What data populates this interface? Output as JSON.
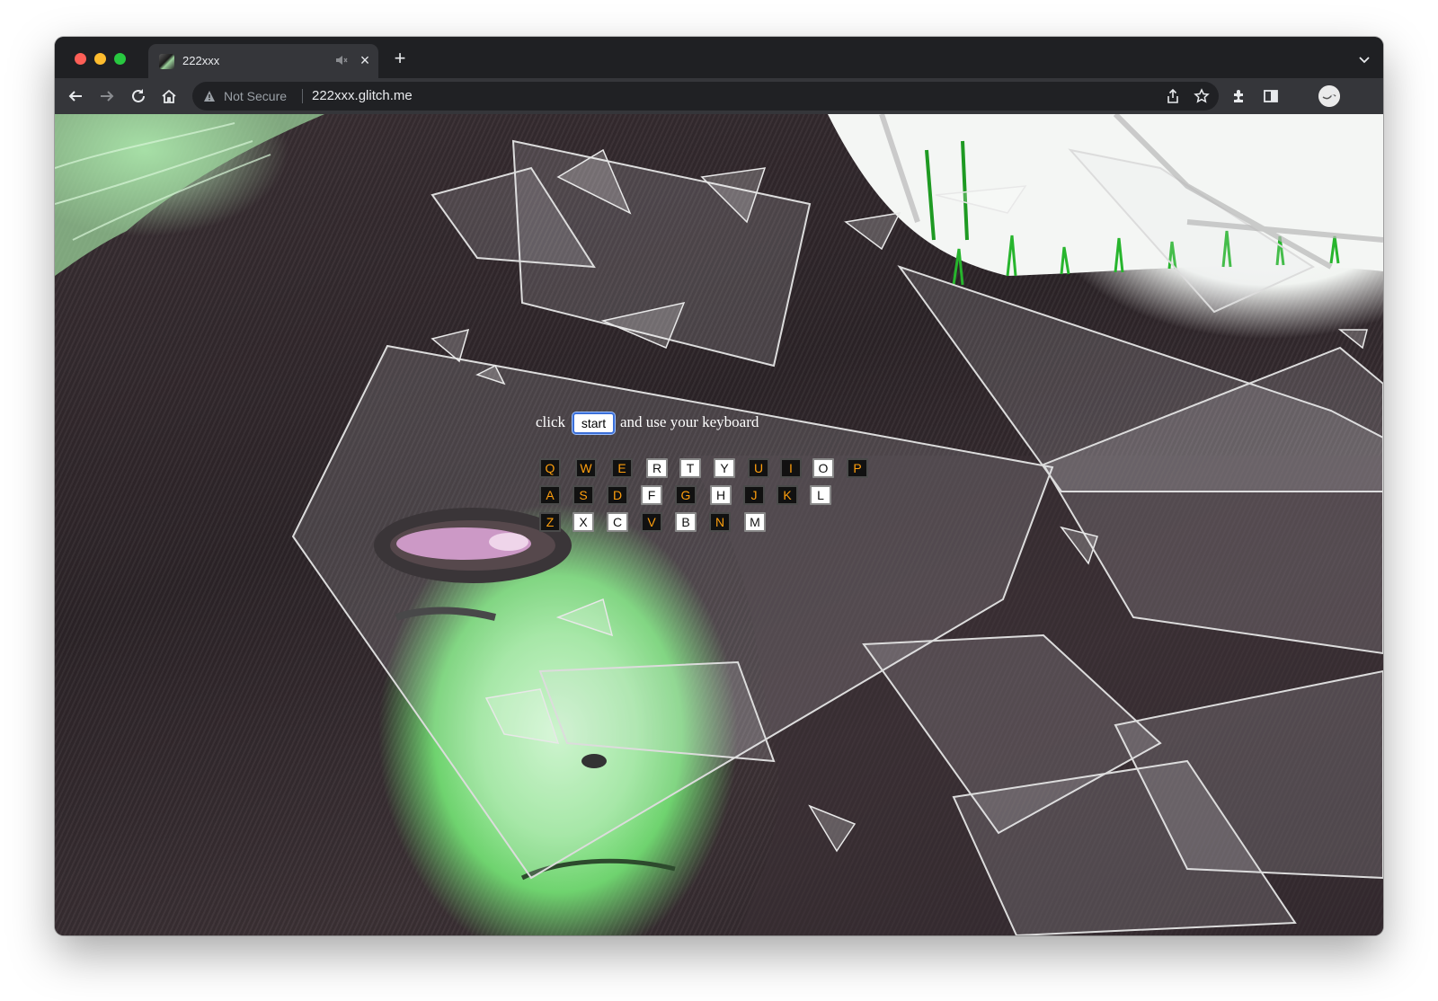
{
  "browser": {
    "tab": {
      "title": "222xxx"
    },
    "address": {
      "security_label": "Not Secure",
      "url": "222xxx.glitch.me"
    }
  },
  "page": {
    "instruction_before": "click",
    "start_label": "start",
    "instruction_after": "and use your keyboard",
    "keyboard": {
      "row1": [
        "Q",
        "W",
        "E",
        "R",
        "T",
        "Y",
        "U",
        "I",
        "O",
        "P"
      ],
      "row2": [
        "A",
        "S",
        "D",
        "F",
        "G",
        "H",
        "J",
        "K",
        "L"
      ],
      "row3": [
        "Z",
        "X",
        "C",
        "V",
        "B",
        "N",
        "M"
      ],
      "lit_keys": [
        "R",
        "T",
        "Y",
        "O",
        "F",
        "H",
        "L",
        "X",
        "C",
        "B",
        "M"
      ]
    },
    "colors": {
      "key_dark_bg": "#111111",
      "key_dark_text": "#ff9f0d",
      "key_light_bg": "#ffffff",
      "focus_ring": "#3b6fd8"
    }
  }
}
